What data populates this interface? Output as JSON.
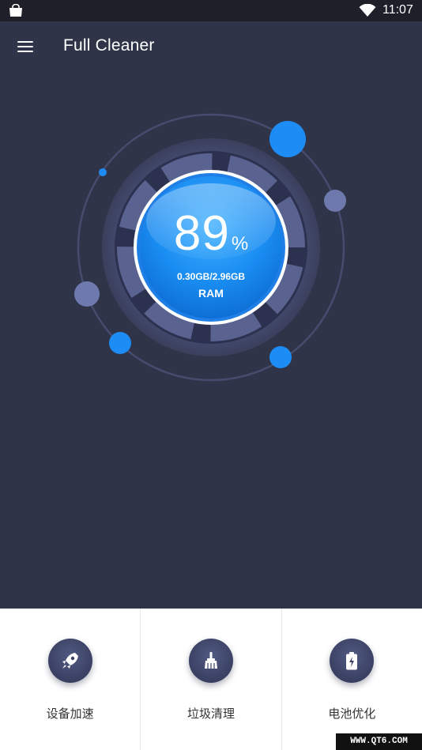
{
  "status_bar": {
    "time": "11:07",
    "icons": [
      "shopping-bag-icon",
      "wifi-icon"
    ]
  },
  "app_bar": {
    "title": "Full Cleaner",
    "menu_icon": "hamburger-menu-icon"
  },
  "gauge": {
    "percent": "89",
    "percent_sign": "%",
    "memory": "0.30GB/2.96GB",
    "label": "RAM",
    "usage_fraction": 0.89
  },
  "actions": [
    {
      "label": "设备加速",
      "icon": "rocket-icon"
    },
    {
      "label": "垃圾清理",
      "icon": "broom-icon"
    },
    {
      "label": "电池优化",
      "icon": "battery-icon"
    }
  ],
  "watermark": "WWW.QT6.COM",
  "colors": {
    "background": "#2f3448",
    "status_bar": "#1e1f29",
    "accent_blue": "#1e8cf5",
    "muted_dot": "#6e7aae",
    "panel": "#ffffff"
  }
}
